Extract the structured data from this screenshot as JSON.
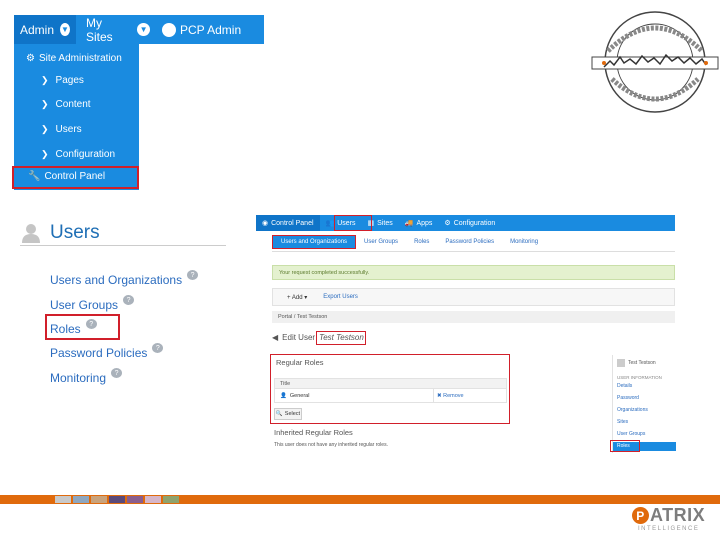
{
  "dockbar": {
    "admin_label": "Admin",
    "my_sites_label": "My Sites",
    "user_label": "PCP Admin"
  },
  "admin_menu": {
    "heading": "Site Administration",
    "items": [
      "Pages",
      "Content",
      "Users",
      "Configuration"
    ],
    "control_panel": "Control Panel"
  },
  "users_panel": {
    "title": "Users",
    "links": [
      "Users and Organizations",
      "User Groups",
      "Roles",
      "Password Policies",
      "Monitoring"
    ]
  },
  "control_panel_shot": {
    "topbar": [
      "Control Panel",
      "Users",
      "Sites",
      "Apps",
      "Configuration"
    ],
    "tabs": [
      "Users and Organizations",
      "User Groups",
      "Roles",
      "Password Policies",
      "Monitoring"
    ],
    "success_message": "Your request completed successfully.",
    "toolbar_add": "Add",
    "toolbar_export": "Export Users",
    "breadcrumb": "Portal / Test Testson",
    "edit_user_label": "Edit User",
    "edit_user_name": "Test Testson",
    "regular_roles_title": "Regular Roles",
    "table_header": "Title",
    "row_title": "General",
    "row_action": "Remove",
    "select_button": "Select",
    "inherited_title": "Inherited Regular Roles",
    "inherited_note": "This user does not have any inherited regular roles.",
    "side_user": "Test Testson",
    "side_section": "USER INFORMATION",
    "side_links": [
      "Details",
      "Password",
      "Organizations",
      "Sites",
      "User Groups",
      "Roles"
    ]
  },
  "footer": {
    "logo_text": "ATRIX",
    "logo_initial": "P",
    "logo_subtitle": "INTELLIGENCE",
    "swatch_colors": [
      "#c9c9c9",
      "#8ea7c0",
      "#c9a37c",
      "#5b4a7a",
      "#8a5e8e",
      "#d6b6c9",
      "#8fa36d"
    ]
  },
  "accent_colors": {
    "dock_blue": "#1a8be0",
    "highlight_red": "#d11f2a",
    "brand_orange": "#e06a0c"
  }
}
